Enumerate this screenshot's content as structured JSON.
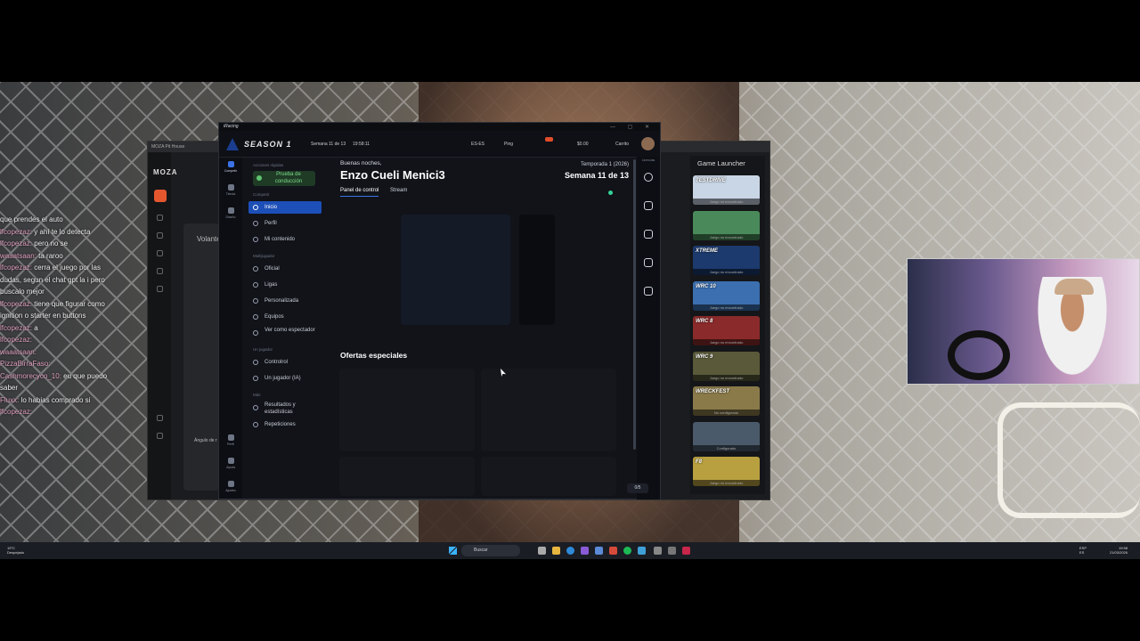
{
  "chat": {
    "lines": [
      {
        "user": "",
        "text": "que prendes el auto"
      },
      {
        "user": "lfcopezaz:",
        "text": "y ahí te lo detecta"
      },
      {
        "user": "lfcopezaz:",
        "text": "pero no se"
      },
      {
        "user": "waaatsaan:",
        "text": "ta raroo"
      },
      {
        "user": "lfcopezaz:",
        "text": "cerra el juego por las"
      },
      {
        "user": "",
        "text": "dudas, segun el chat gpt la i pero"
      },
      {
        "user": "",
        "text": "buscalo mejor"
      },
      {
        "user": "lfcopezaz:",
        "text": "tiene que figurar como"
      },
      {
        "user": "",
        "text": "ignition o starter en buttons"
      },
      {
        "user": "lfcopezaz:",
        "text": "a"
      },
      {
        "user": "lfcopezaz:",
        "text": ""
      },
      {
        "user": "waaatsaan:",
        "text": ""
      },
      {
        "user": "PizzaBirraFaso:",
        "text": ""
      },
      {
        "user": "Cashmorecyco_10:",
        "text": "eu que puedo"
      },
      {
        "user": "",
        "text": "saber"
      },
      {
        "user": "Fluxx:",
        "text": "lo habias comprado si"
      },
      {
        "user": "lfcopezaz:",
        "text": ""
      }
    ]
  },
  "moza": {
    "logo": "MOZA",
    "volante": "Volante",
    "angulo": "Ángulo de r"
  },
  "game_launcher": {
    "title": "Game Launcher",
    "games": [
      {
        "name": "TESTDRIVE",
        "status": "Juego no encontrado",
        "color": "#c9d6e6"
      },
      {
        "name": "",
        "status": "Juego no encontrado",
        "color": "#4a8a5a"
      },
      {
        "name": "XTREME",
        "status": "Juego no encontrado",
        "color": "#1c3a6e"
      },
      {
        "name": "WRC 10",
        "status": "Juego no encontrado",
        "color": "#3b6fb0"
      },
      {
        "name": "WRC 8",
        "status": "Juego no encontrado",
        "color": "#8a2a2a"
      },
      {
        "name": "WRC 9",
        "status": "Juego no encontrado",
        "color": "#5a5a3a"
      },
      {
        "name": "WRECKFEST",
        "status": "No configurado",
        "color": "#8a7a4a"
      },
      {
        "name": "",
        "status": "Configurado",
        "color": "#4a5a6a"
      },
      {
        "name": "F8",
        "status": "Juego no encontrado",
        "color": "#b8a040"
      }
    ]
  },
  "iracing": {
    "window_title": "iRacing",
    "season": "SEASON 1",
    "week_small": "Semana 11 de 13",
    "clock": "19:58:11",
    "lang": "ES-ES",
    "ping": "Ping",
    "balance": "$0.00",
    "cart": "Carrito",
    "rail": {
      "competir": "Competir",
      "tienda": "Tienda",
      "disenio": "Diseño",
      "perfil": "Perfil",
      "ayuda": "Ayuda",
      "ajustes": "Ajustes"
    },
    "nav": {
      "quick_actions": "Acciones rápidas",
      "drive_test": "Prueba de conducción",
      "competir_label": "Competir",
      "inicio": "Inicio",
      "perfil": "Perfil",
      "mi_contenido": "Mi contenido",
      "multijugador": "Multijugador",
      "oficial": "Oficial",
      "ligas": "Ligas",
      "personalizada": "Personalizada",
      "equipos": "Equipos",
      "ver_espectador": "Ver como espectador",
      "un_jugador_label": "Un jugador",
      "controlrol": "Controlrol",
      "un_jugador_ia": "Un jugador (IA)",
      "mas": "Más",
      "resultados": "Resultados y estadísticas",
      "repeticiones": "Repeticiones"
    },
    "main": {
      "greeting": "Buenas noches,",
      "user_name": "Enzo Cueli Menici3",
      "season_label": "Temporada 1 (2026)",
      "week_label": "Semana 11 de 13",
      "tab_panel": "Panel de control",
      "tab_stream": "Stream",
      "offers_title": "Ofertas especiales",
      "counter": "0/5"
    },
    "right_rail": {
      "licencias": "Licencias"
    }
  },
  "taskbar": {
    "weather_temp": "19°C",
    "weather_desc": "Despejado",
    "search": "Buscar",
    "lang1": "ESP",
    "lang2": "ES",
    "time": "19:58",
    "date": "21/03/2026"
  }
}
